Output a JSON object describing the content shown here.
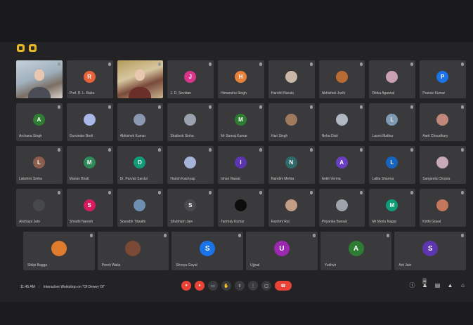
{
  "window_controls": [
    {
      "name": "left-control"
    },
    {
      "name": "right-control"
    }
  ],
  "participants_rows": [
    [
      {
        "name": "",
        "video": "video1"
      },
      {
        "name": "Prof. R. L. Babu",
        "initial": "R",
        "color": "#e8633a"
      },
      {
        "name": "",
        "video": "video2"
      },
      {
        "name": "J. D. Sevidan",
        "initial": "J",
        "color": "#d9368b"
      },
      {
        "name": "Himanshu Singh",
        "initial": "H",
        "color": "#e8823a"
      },
      {
        "name": "Harshit Narula",
        "photo": "#c9b8a5"
      },
      {
        "name": "Abhishek Joshi",
        "photo": "#b86c34"
      },
      {
        "name": "Ritika Agarwal",
        "photo": "#c99fb4"
      },
      {
        "name": "Pranav Kumar",
        "initial": "P",
        "color": "#1a73e8"
      }
    ],
    [
      {
        "name": "Archana Singh",
        "initial": "A",
        "color": "#2e7d32"
      },
      {
        "name": "Gurvinder Bedi",
        "photo": "#a8b9e8"
      },
      {
        "name": "Abhishek Kumar",
        "photo": "#8a97b0"
      },
      {
        "name": "Shailesh Sinha",
        "photo": "#9aa3ad"
      },
      {
        "name": "Mr Sooraj Kumar",
        "initial": "M",
        "color": "#2e7d32"
      },
      {
        "name": "Hari Singh",
        "photo": "#a07a5c"
      },
      {
        "name": "Neha Dixit",
        "photo": "#b0b8c4"
      },
      {
        "name": "Laxmi Mathur",
        "initial": "L",
        "color": "#7f9ab3"
      },
      {
        "name": "Aarti Choudhary",
        "photo": "#c1887a"
      }
    ],
    [
      {
        "name": "Lakshmi Sinha",
        "initial": "L",
        "color": "#8c5e4e"
      },
      {
        "name": "Manav Bhatt",
        "initial": "M",
        "color": "#2e8b57"
      },
      {
        "name": "Dr. Parvati Sardul",
        "initial": "D",
        "color": "#0f9d77"
      },
      {
        "name": "Harish Kashyap",
        "photo": "#a6b3d9"
      },
      {
        "name": "Ishan Rawat",
        "initial": "I",
        "color": "#5e35b1"
      },
      {
        "name": "Nandini Mehta",
        "initial": "N",
        "color": "#2f6b6b"
      },
      {
        "name": "Ankit Verma",
        "initial": "A",
        "color": "#6a3fc4"
      },
      {
        "name": "Lalita Sharma",
        "initial": "L",
        "color": "#1565c0"
      },
      {
        "name": "Sangeeta Chopra",
        "photo": "#c9a9b5"
      }
    ],
    [
      {
        "name": "Akshaya Jain",
        "photo": "#46484c"
      },
      {
        "name": "Shruthi Naresh",
        "initial": "S",
        "color": "#d81b60"
      },
      {
        "name": "Sourabh Tripathi",
        "photo": "#6d8fb1"
      },
      {
        "name": "Shubham Jain",
        "initial": "S",
        "color": "#4a4a4e"
      },
      {
        "name": "Tanmay Kumar",
        "photo": "#0d0d0d"
      },
      {
        "name": "Rashmi Rai",
        "photo": "#c49d87"
      },
      {
        "name": "Priyanka Bansal",
        "photo": "#9da4ab"
      },
      {
        "name": "Mr Monu Nagar",
        "initial": "M",
        "color": "#0f9d77"
      },
      {
        "name": "Kirthi Goyal",
        "photo": "#c4775d"
      }
    ]
  ],
  "last_row": [
    {
      "name": "Shilpi Bagga",
      "photo": "#e07a2c"
    },
    {
      "name": "Preeti Walia",
      "photo": "#7a4a36"
    },
    {
      "name": "Shreya Goyal",
      "initial": "S",
      "color": "#1a73e8"
    },
    {
      "name": "Ujjwal",
      "initial": "U",
      "color": "#9c27b0"
    },
    {
      "name": "Yudhvir",
      "initial": "A",
      "color": "#2e7d32"
    },
    {
      "name": "Arti Jain",
      "initial": "S",
      "color": "#5e35b1"
    }
  ],
  "bottom": {
    "time": "11:45 AM",
    "meeting_title": "Interactive Workshop on \"Of Dewey Of\"",
    "controls": [
      "mic",
      "camera",
      "captions",
      "raise-hand",
      "present",
      "more",
      "options",
      "end-call"
    ],
    "right_controls": [
      "info",
      "people",
      "chat",
      "activities",
      "lock"
    ],
    "people_count": "46"
  }
}
